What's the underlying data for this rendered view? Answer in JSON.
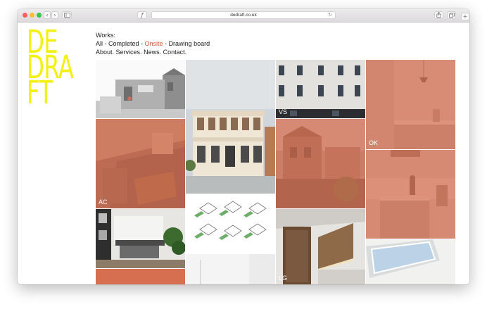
{
  "browser": {
    "url": "dedraft.co.uk",
    "reader_label": "ƒ"
  },
  "logo": {
    "lines": [
      "DE",
      "DRA",
      "FT"
    ]
  },
  "nav": {
    "works_label": "Works:",
    "filters": [
      "All",
      "Completed",
      "Onsite",
      "Drawing board"
    ],
    "separator": " - ",
    "active_filter": "Onsite",
    "links": [
      "About.",
      "Services.",
      "News.",
      "Contact."
    ]
  },
  "projects": [
    {
      "id": "p1",
      "label": ""
    },
    {
      "id": "p2",
      "label": "AC"
    },
    {
      "id": "p3",
      "label": ""
    },
    {
      "id": "p4",
      "label": ""
    },
    {
      "id": "p5",
      "label": ""
    },
    {
      "id": "p6",
      "label": ""
    },
    {
      "id": "p7",
      "label": ""
    },
    {
      "id": "p8",
      "label": "VS"
    },
    {
      "id": "p9",
      "label": ""
    },
    {
      "id": "p10",
      "label": "LG"
    },
    {
      "id": "p11",
      "label": "OK"
    },
    {
      "id": "p12",
      "label": ""
    }
  ],
  "colors": {
    "logo_yellow": "#f3f016",
    "accent": "#d05c3d",
    "overlay": "#d66e50"
  }
}
